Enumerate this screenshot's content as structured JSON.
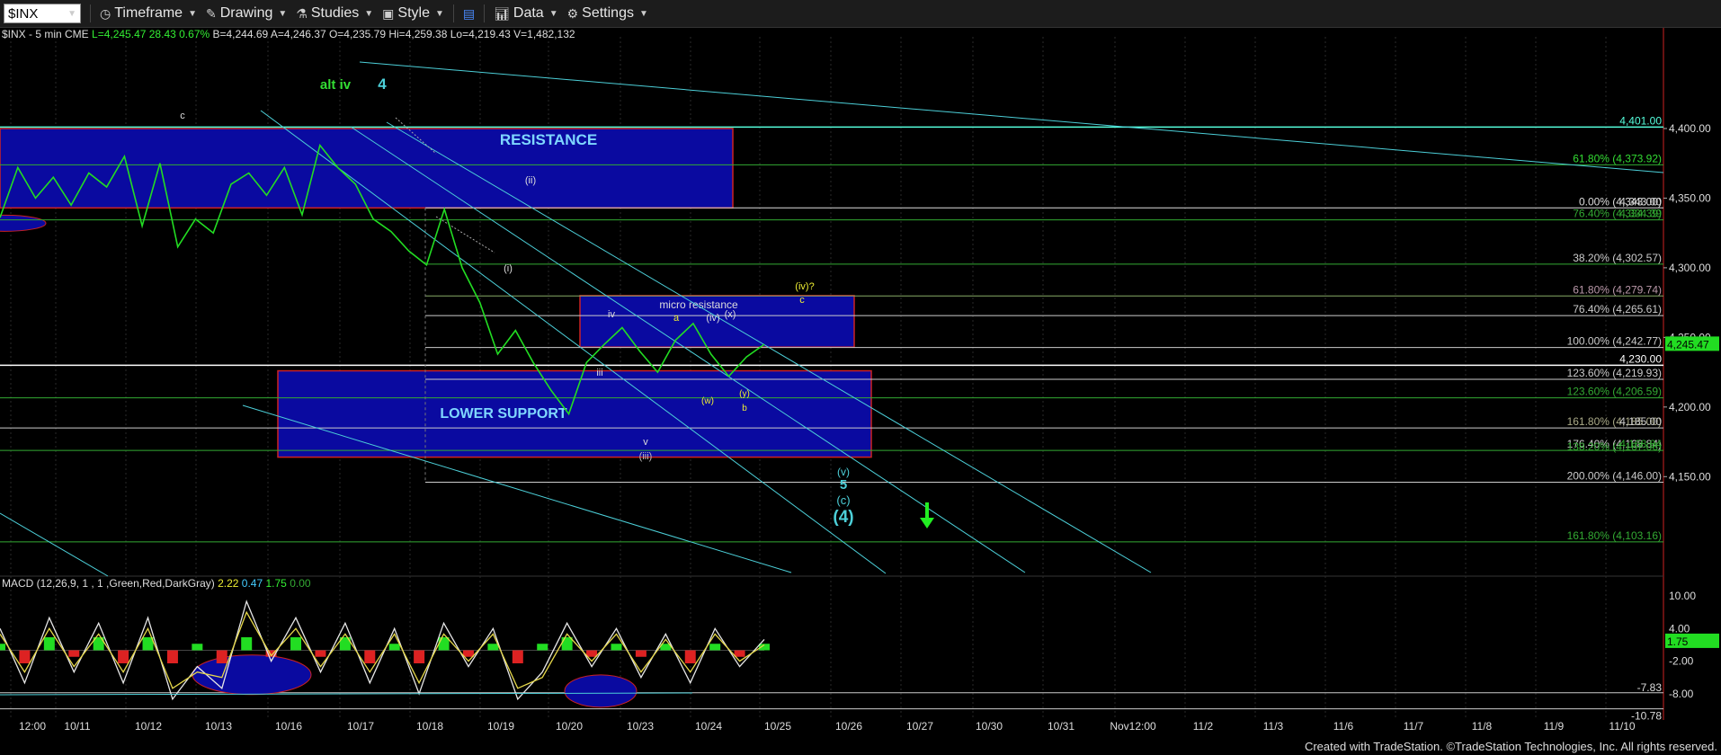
{
  "toolbar": {
    "symbol": "$INX",
    "timeframe": "Timeframe",
    "drawing": "Drawing",
    "studies": "Studies",
    "style": "Style",
    "data": "Data",
    "settings": "Settings"
  },
  "header": {
    "instrument": "$INX - 5 min  CME",
    "last": "L=4,245.47",
    "change": "28.43",
    "change_pct": "0.67%",
    "bid": "B=4,244.69",
    "ask": "A=4,246.37",
    "open": "O=4,235.79",
    "high": "Hi=4,259.38",
    "low": "Lo=4,219.43",
    "volume": "V=1,482,132"
  },
  "chart_data": [
    {
      "type": "line",
      "panel": "price",
      "ylim": [
        4085,
        4440
      ],
      "ticks_y": [
        4150,
        4200,
        4250,
        4300,
        4350,
        4400
      ],
      "tick_labels_y": [
        "4,150.00",
        "4,200.00",
        "4,250.00",
        "4,300.00",
        "4,350.00",
        "4,400.00"
      ],
      "x_labels": [
        "12:00",
        "10/11",
        "10/12",
        "10/13",
        "10/16",
        "10/17",
        "10/18",
        "10/19",
        "10/20",
        "10/23",
        "10/24",
        "10/25",
        "10/26",
        "10/27",
        "10/30",
        "10/31",
        "Nov12:00",
        "11/2",
        "11/3",
        "11/6",
        "11/7",
        "11/8",
        "11/9",
        "11/10"
      ],
      "series": [
        {
          "color": "#22dd22",
          "values": [
            4336,
            4372,
            4350,
            4365,
            4345,
            4368,
            4358,
            4380,
            4330,
            4375,
            4315,
            4335,
            4325,
            4360,
            4368,
            4352,
            4372,
            4338,
            4388,
            4372,
            4360,
            4335,
            4326,
            4312,
            4302,
            4342,
            4300,
            4275,
            4238,
            4255,
            4232,
            4212,
            4195,
            4232,
            4245,
            4257,
            4240,
            4225,
            4248,
            4260,
            4238,
            4222,
            4236,
            4245
          ]
        }
      ],
      "last_price": "4,245.47",
      "scale_labels": [
        "4,401.00",
        "4,343.00",
        "4,334.39",
        "4,230.00",
        "4,185.00",
        "4,168.84"
      ],
      "fib_labels": [
        "61.80% (4,373.92)",
        "0.00% (4,343.00)",
        "76.40% (4,334.39)",
        "38.20% (4,302.57)",
        "61.80% (4,279.74)",
        "76.40% (4,265.61)",
        "100.00% (4,242.77)",
        "123.60% (4,219.93)",
        "123.60% (4,206.59)",
        "161.80% (4,185.00)",
        "176.40% (4,168.84)",
        "138.20% (4,167.06)",
        "200.00% (4,146.00)",
        "161.80% (4,103.16)"
      ],
      "zones": [
        "RESISTANCE",
        "micro resistance",
        "LOWER SUPPORT"
      ],
      "annotations": [
        "alt iv",
        "4",
        "c",
        "(ii)",
        "(i)",
        "iv",
        "iii",
        "v",
        "(iii)",
        "a",
        "(iv)",
        "(x)",
        "(w)",
        "(y)",
        "b",
        "(iv)?",
        "c",
        "(v)",
        "5",
        "(c)",
        "(4)"
      ]
    },
    {
      "type": "line",
      "panel": "macd",
      "title": "MACD (12,26,9, 1 , 1 ,Green,Red,DarkGray)",
      "values_readout": [
        "2.22",
        "0.47",
        "1.75",
        "0.00"
      ],
      "ylim": [
        -12,
        12
      ],
      "tick_labels_y": [
        "10.00",
        "4.00",
        "-2.00",
        "-8.00"
      ],
      "level_labels": [
        "-7.83",
        "-10.78"
      ],
      "last_value": "1.75",
      "series": [
        {
          "name": "MACD",
          "color": "#e6e6e6",
          "values": [
            4,
            -6,
            6,
            -4,
            5,
            -6,
            6,
            -9,
            -3,
            -7,
            9,
            -2,
            6,
            -4,
            5,
            -6,
            4,
            -8,
            5,
            -3,
            4,
            -9,
            -4,
            5,
            -3,
            4,
            -5,
            3,
            -6,
            4,
            -3,
            2
          ]
        },
        {
          "name": "Signal",
          "color": "#e6d84a",
          "values": [
            3,
            -4,
            4,
            -3,
            3,
            -4,
            4,
            -7,
            -4,
            -5,
            7,
            -1,
            4,
            -3,
            3,
            -4,
            3,
            -6,
            3,
            -2,
            3,
            -7,
            -5,
            3,
            -2,
            3,
            -4,
            2,
            -4,
            3,
            -2,
            1
          ]
        }
      ]
    }
  ],
  "footer": "Created with TradeStation. ©TradeStation Technologies, Inc. All rights reserved."
}
